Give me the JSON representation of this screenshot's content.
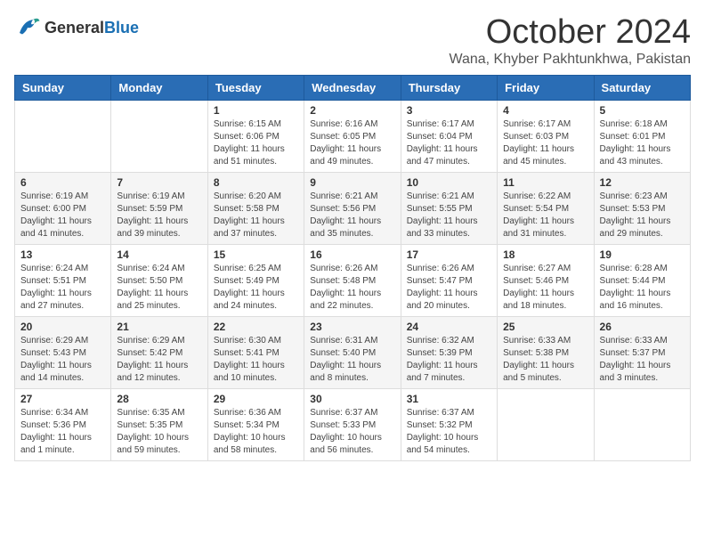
{
  "header": {
    "logo_general": "General",
    "logo_blue": "Blue",
    "title": "October 2024",
    "subtitle": "Wana, Khyber Pakhtunkhwa, Pakistan"
  },
  "days_of_week": [
    "Sunday",
    "Monday",
    "Tuesday",
    "Wednesday",
    "Thursday",
    "Friday",
    "Saturday"
  ],
  "weeks": [
    [
      {
        "day": "",
        "sunrise": "",
        "sunset": "",
        "daylight": ""
      },
      {
        "day": "",
        "sunrise": "",
        "sunset": "",
        "daylight": ""
      },
      {
        "day": "1",
        "sunrise": "Sunrise: 6:15 AM",
        "sunset": "Sunset: 6:06 PM",
        "daylight": "Daylight: 11 hours and 51 minutes."
      },
      {
        "day": "2",
        "sunrise": "Sunrise: 6:16 AM",
        "sunset": "Sunset: 6:05 PM",
        "daylight": "Daylight: 11 hours and 49 minutes."
      },
      {
        "day": "3",
        "sunrise": "Sunrise: 6:17 AM",
        "sunset": "Sunset: 6:04 PM",
        "daylight": "Daylight: 11 hours and 47 minutes."
      },
      {
        "day": "4",
        "sunrise": "Sunrise: 6:17 AM",
        "sunset": "Sunset: 6:03 PM",
        "daylight": "Daylight: 11 hours and 45 minutes."
      },
      {
        "day": "5",
        "sunrise": "Sunrise: 6:18 AM",
        "sunset": "Sunset: 6:01 PM",
        "daylight": "Daylight: 11 hours and 43 minutes."
      }
    ],
    [
      {
        "day": "6",
        "sunrise": "Sunrise: 6:19 AM",
        "sunset": "Sunset: 6:00 PM",
        "daylight": "Daylight: 11 hours and 41 minutes."
      },
      {
        "day": "7",
        "sunrise": "Sunrise: 6:19 AM",
        "sunset": "Sunset: 5:59 PM",
        "daylight": "Daylight: 11 hours and 39 minutes."
      },
      {
        "day": "8",
        "sunrise": "Sunrise: 6:20 AM",
        "sunset": "Sunset: 5:58 PM",
        "daylight": "Daylight: 11 hours and 37 minutes."
      },
      {
        "day": "9",
        "sunrise": "Sunrise: 6:21 AM",
        "sunset": "Sunset: 5:56 PM",
        "daylight": "Daylight: 11 hours and 35 minutes."
      },
      {
        "day": "10",
        "sunrise": "Sunrise: 6:21 AM",
        "sunset": "Sunset: 5:55 PM",
        "daylight": "Daylight: 11 hours and 33 minutes."
      },
      {
        "day": "11",
        "sunrise": "Sunrise: 6:22 AM",
        "sunset": "Sunset: 5:54 PM",
        "daylight": "Daylight: 11 hours and 31 minutes."
      },
      {
        "day": "12",
        "sunrise": "Sunrise: 6:23 AM",
        "sunset": "Sunset: 5:53 PM",
        "daylight": "Daylight: 11 hours and 29 minutes."
      }
    ],
    [
      {
        "day": "13",
        "sunrise": "Sunrise: 6:24 AM",
        "sunset": "Sunset: 5:51 PM",
        "daylight": "Daylight: 11 hours and 27 minutes."
      },
      {
        "day": "14",
        "sunrise": "Sunrise: 6:24 AM",
        "sunset": "Sunset: 5:50 PM",
        "daylight": "Daylight: 11 hours and 25 minutes."
      },
      {
        "day": "15",
        "sunrise": "Sunrise: 6:25 AM",
        "sunset": "Sunset: 5:49 PM",
        "daylight": "Daylight: 11 hours and 24 minutes."
      },
      {
        "day": "16",
        "sunrise": "Sunrise: 6:26 AM",
        "sunset": "Sunset: 5:48 PM",
        "daylight": "Daylight: 11 hours and 22 minutes."
      },
      {
        "day": "17",
        "sunrise": "Sunrise: 6:26 AM",
        "sunset": "Sunset: 5:47 PM",
        "daylight": "Daylight: 11 hours and 20 minutes."
      },
      {
        "day": "18",
        "sunrise": "Sunrise: 6:27 AM",
        "sunset": "Sunset: 5:46 PM",
        "daylight": "Daylight: 11 hours and 18 minutes."
      },
      {
        "day": "19",
        "sunrise": "Sunrise: 6:28 AM",
        "sunset": "Sunset: 5:44 PM",
        "daylight": "Daylight: 11 hours and 16 minutes."
      }
    ],
    [
      {
        "day": "20",
        "sunrise": "Sunrise: 6:29 AM",
        "sunset": "Sunset: 5:43 PM",
        "daylight": "Daylight: 11 hours and 14 minutes."
      },
      {
        "day": "21",
        "sunrise": "Sunrise: 6:29 AM",
        "sunset": "Sunset: 5:42 PM",
        "daylight": "Daylight: 11 hours and 12 minutes."
      },
      {
        "day": "22",
        "sunrise": "Sunrise: 6:30 AM",
        "sunset": "Sunset: 5:41 PM",
        "daylight": "Daylight: 11 hours and 10 minutes."
      },
      {
        "day": "23",
        "sunrise": "Sunrise: 6:31 AM",
        "sunset": "Sunset: 5:40 PM",
        "daylight": "Daylight: 11 hours and 8 minutes."
      },
      {
        "day": "24",
        "sunrise": "Sunrise: 6:32 AM",
        "sunset": "Sunset: 5:39 PM",
        "daylight": "Daylight: 11 hours and 7 minutes."
      },
      {
        "day": "25",
        "sunrise": "Sunrise: 6:33 AM",
        "sunset": "Sunset: 5:38 PM",
        "daylight": "Daylight: 11 hours and 5 minutes."
      },
      {
        "day": "26",
        "sunrise": "Sunrise: 6:33 AM",
        "sunset": "Sunset: 5:37 PM",
        "daylight": "Daylight: 11 hours and 3 minutes."
      }
    ],
    [
      {
        "day": "27",
        "sunrise": "Sunrise: 6:34 AM",
        "sunset": "Sunset: 5:36 PM",
        "daylight": "Daylight: 11 hours and 1 minute."
      },
      {
        "day": "28",
        "sunrise": "Sunrise: 6:35 AM",
        "sunset": "Sunset: 5:35 PM",
        "daylight": "Daylight: 10 hours and 59 minutes."
      },
      {
        "day": "29",
        "sunrise": "Sunrise: 6:36 AM",
        "sunset": "Sunset: 5:34 PM",
        "daylight": "Daylight: 10 hours and 58 minutes."
      },
      {
        "day": "30",
        "sunrise": "Sunrise: 6:37 AM",
        "sunset": "Sunset: 5:33 PM",
        "daylight": "Daylight: 10 hours and 56 minutes."
      },
      {
        "day": "31",
        "sunrise": "Sunrise: 6:37 AM",
        "sunset": "Sunset: 5:32 PM",
        "daylight": "Daylight: 10 hours and 54 minutes."
      },
      {
        "day": "",
        "sunrise": "",
        "sunset": "",
        "daylight": ""
      },
      {
        "day": "",
        "sunrise": "",
        "sunset": "",
        "daylight": ""
      }
    ]
  ]
}
